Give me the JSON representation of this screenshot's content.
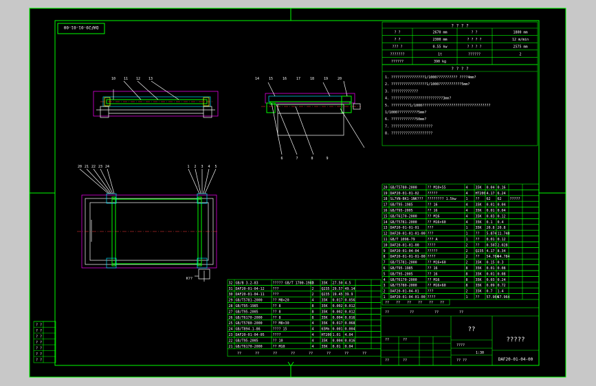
{
  "drawing": {
    "code_box": "DAF20-01-01-00",
    "code_main": "DAF20-01-04-00",
    "title_cn": "??",
    "company": "?????",
    "scale_labels": [
      "????",
      "?? ??",
      "????"
    ],
    "scale_values": [
      "1:30",
      "?????"
    ],
    "view_label": "K??"
  },
  "params": {
    "title": "? ? ? ?",
    "rows": [
      [
        "?  ?",
        "2670 mm",
        "?  ?",
        "1800 mm"
      ],
      [
        "?  ?",
        "2300 mm",
        "? ? ? ?",
        "12 m/min"
      ],
      [
        "??? ?",
        "0.55 kw",
        "? ? ? ?",
        "2575 mm"
      ],
      [
        "???????",
        "1t",
        "??????",
        "2"
      ],
      [
        "??????",
        "390 kg",
        "",
        ""
      ]
    ]
  },
  "tech": {
    "title": "? ? ? ?",
    "lines": [
      "1. ????????????????1/1000?????????? ????4mm?",
      "2. ?????????????????1/1000???????????5mm?",
      "3. ?????????????",
      "4. ?????????????????????????3mm?",
      "5. ?????????1/1000?????????????????????????????????",
      "   1/1000??????????5mm?",
      "6. ????????????50mm?",
      "7. ????????????????????",
      "8. ????????????????????"
    ]
  },
  "bom_right": [
    [
      "20",
      "GB/T5780-2000",
      "?? M10×55",
      "4",
      "35K",
      "0.04",
      "0.16",
      ""
    ],
    [
      "19",
      "DAF20-01-01-02",
      "?????",
      "4",
      "HT200",
      "4.17",
      "6.24",
      ""
    ],
    [
      "18",
      "SL7VN-BK1-1NK???",
      "???????? 1.5kw",
      "1",
      "??",
      "62",
      "62",
      "?????"
    ],
    [
      "17",
      "GB/T95-1985",
      "?? 16",
      "4",
      "35K",
      "0.01",
      "0.04",
      ""
    ],
    [
      "16",
      "GB/T95-2005",
      "?? 16",
      "4",
      "35K",
      "0.01",
      "0.04",
      ""
    ],
    [
      "15",
      "GB/T6170-2000",
      "?? M16",
      "4",
      "35K",
      "0.03",
      "0.12",
      ""
    ],
    [
      "14",
      "GB/T5781-2000",
      "?? M16×60",
      "4",
      "35K",
      "0.1",
      "0.4",
      ""
    ],
    [
      "13",
      "DAF20-01-01-01",
      "???",
      "1",
      "35K",
      "20.8",
      "20.8",
      ""
    ],
    [
      "12",
      "DAF20-01-01-01-00",
      "???",
      "1",
      "??",
      "5.874",
      "11.748",
      ""
    ],
    [
      "11",
      "GB/T 1096-79",
      "??? A",
      "1",
      "??",
      "0.01",
      "0.12",
      ""
    ],
    [
      "10",
      "DAF20-01-01-00",
      "????",
      "2",
      "??",
      "0.507",
      "2.028",
      ""
    ],
    [
      "9",
      "DAF20-01-04-04",
      "?????",
      "2",
      "Q235",
      "4.17",
      "8.34",
      ""
    ],
    [
      "8",
      "DAF20-01-01-01-00",
      "????",
      "2",
      "??",
      "54.784",
      "54.784",
      ""
    ],
    [
      "7",
      "GB/T5781-2000",
      "?? M16×60",
      "2",
      "35K",
      "0.15",
      "0.3",
      ""
    ],
    [
      "6",
      "GB/T95-1985",
      "?? 16",
      "8",
      "35K",
      "0.01",
      "0.08",
      ""
    ],
    [
      "5",
      "GB/T95-2005",
      "?? 16",
      "8",
      "35K",
      "0.01",
      "0.08",
      ""
    ],
    [
      "4",
      "GB/T6170-2000",
      "?? M16",
      "8",
      "35K",
      "0.03",
      "0.24",
      ""
    ],
    [
      "3",
      "GB/T5780-2000",
      "?? M16×60",
      "8",
      "35K",
      "0.09",
      "0.72",
      ""
    ],
    [
      "2",
      "DAF20-01-04-01",
      "???",
      "2",
      "35K",
      "0.7",
      "1.4",
      ""
    ],
    [
      "1",
      "DAF20-01-04-01-00",
      "????",
      "1",
      "??",
      "57.964",
      "57.964",
      ""
    ]
  ],
  "bom_left": [
    [
      "32",
      "GB/B 3.2-83",
      "????? GB/T 1700-1985",
      "2",
      "35K",
      "27.50",
      "4.5"
    ],
    [
      "31",
      "DAF20-01-04-12",
      "???",
      "2",
      "Q235",
      "29.57",
      "49.14"
    ],
    [
      "30",
      "DAF20-01-04-11",
      "???",
      "2",
      "Q235",
      "19.45",
      "39.9"
    ],
    [
      "29",
      "GB/T5781-2000",
      "?? M8×20",
      "4",
      "35K",
      "0.017",
      "0.056"
    ],
    [
      "28",
      "GB/T95-1985",
      "?? 8",
      "8",
      "35K",
      "0.002",
      "0.012"
    ],
    [
      "27",
      "GB/T95-2005",
      "?? 8",
      "8",
      "35K",
      "0.002",
      "0.012"
    ],
    [
      "26",
      "GB/T6170-2000",
      "?? 8",
      "8",
      "35K",
      "0.004",
      "0.016"
    ],
    [
      "25",
      "GB/T5780-2000",
      "?? M8×30",
      "4",
      "35K",
      "0.017",
      "0.068"
    ],
    [
      "24",
      "GB/T894.1-86",
      "???? 15",
      "4",
      "65Mn",
      "0.001",
      "0.004"
    ],
    [
      "23",
      "DAF20-01-04-05",
      "????",
      "4",
      "HT200",
      "1.01",
      "4.04"
    ],
    [
      "22",
      "GB/T95-2005",
      "?? 10",
      "4",
      "35K",
      "0.004",
      "0.016"
    ],
    [
      "21",
      "GB/T6170-2000",
      "?? M10",
      "4",
      "35K",
      "0.01",
      "0.04"
    ]
  ],
  "bom_header": [
    "??",
    "??",
    "??",
    "??",
    "??",
    "??",
    "??",
    "??"
  ],
  "left_strip": [
    "? ?",
    "? ?",
    "? ?",
    "? ?",
    "? ?",
    "? ?",
    "? ?"
  ],
  "sig_rows": [
    [
      "??",
      "??",
      "??",
      "??",
      "??",
      "??"
    ],
    [
      "??",
      "??",
      "??"
    ],
    [
      "??",
      "??"
    ]
  ],
  "callouts": {
    "front": [
      "10",
      "11",
      "12",
      "13"
    ],
    "side": [
      "14",
      "15",
      "16",
      "17",
      "18",
      "19",
      "20"
    ],
    "plan_left": [
      "20",
      "21",
      "22",
      "23",
      "24"
    ],
    "plan_right": [
      "1",
      "2",
      "3",
      "4",
      "5"
    ],
    "side_bottom": [
      "6",
      "7",
      "8",
      "9"
    ]
  }
}
